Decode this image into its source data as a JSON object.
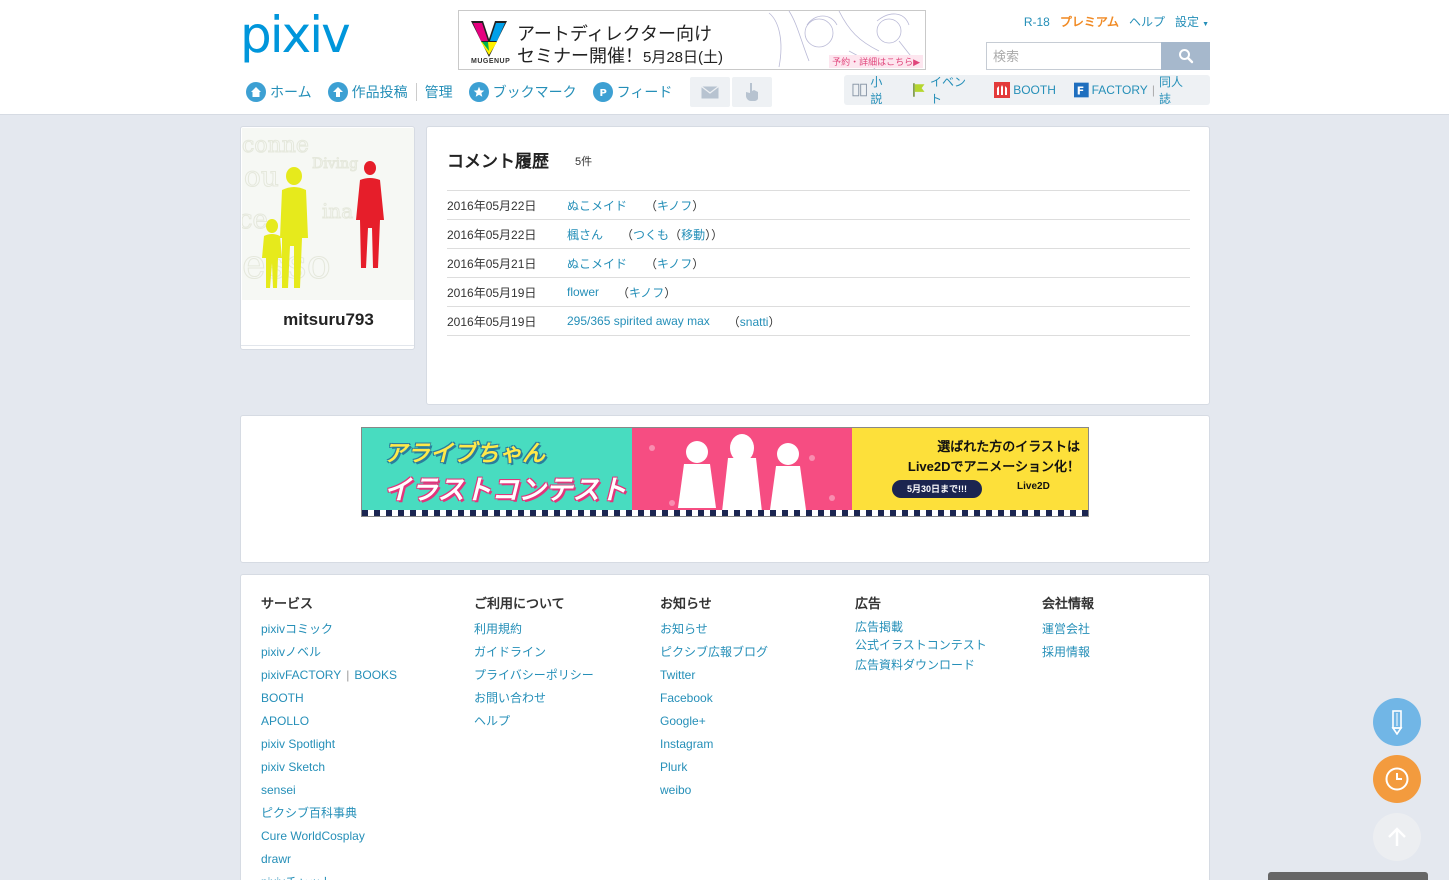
{
  "header": {
    "logo_text": "pixiv",
    "top_ad": {
      "brand": "MUGENUP",
      "line1": "アートディレクター向け",
      "line2": "セミナー開催！",
      "date": "5月28日(土)",
      "more": "予約・詳細はこちら▶"
    },
    "top_links": {
      "r18": "R-18",
      "premium": "プレミアム",
      "help": "ヘルプ",
      "settings": "設定"
    },
    "search": {
      "placeholder": "検索"
    },
    "nav": {
      "home": "ホーム",
      "post": "作品投稿",
      "manage": "管理",
      "bookmark": "ブックマーク",
      "feed": "フィード"
    },
    "services": {
      "novel": "小説",
      "event": "イベント",
      "booth": "BOOTH",
      "factory": "FACTORY",
      "doujin": "同人誌"
    }
  },
  "profile": {
    "username": "mitsuru793"
  },
  "history": {
    "title": "コメント履歴",
    "count": "5件",
    "rows": [
      {
        "date": "2016年05月22日",
        "title": "ぬこメイド",
        "author": "キノフ",
        "suffix": ""
      },
      {
        "date": "2016年05月22日",
        "title": "楓さん",
        "author": "つくも",
        "suffix": "移動"
      },
      {
        "date": "2016年05月21日",
        "title": "ぬこメイド",
        "author": "キノフ",
        "suffix": ""
      },
      {
        "date": "2016年05月19日",
        "title": "flower",
        "author": "キノフ",
        "suffix": ""
      },
      {
        "date": "2016年05月19日",
        "title": "295/365 spirited away max",
        "author": "snatti",
        "suffix": ""
      }
    ]
  },
  "banner": {
    "title1": "アライブちゃん",
    "title2": "イラストコンテスト",
    "right1": "選ばれた方のイラストは",
    "right2": "Live2Dでアニメーション化！",
    "deadline": "5月30日まで!!!",
    "brand": "Live2D"
  },
  "footer": {
    "services": {
      "heading": "サービス",
      "items": [
        "pixivコミック",
        "pixivノベル",
        "pixivFACTORY",
        "BOOKS",
        "BOOTH",
        "APOLLO",
        "pixiv Spotlight",
        "pixiv Sketch",
        "sensei",
        "ピクシブ百科事典",
        "Cure WorldCosplay",
        "drawr",
        "pixivチャット"
      ]
    },
    "usage": {
      "heading": "ご利用について",
      "items": [
        "利用規約",
        "ガイドライン",
        "プライバシーポリシー",
        "お問い合わせ",
        "ヘルプ"
      ]
    },
    "news": {
      "heading": "お知らせ",
      "items": [
        "お知らせ",
        "ピクシブ広報ブログ",
        "Twitter",
        "Facebook",
        "Google+",
        "Instagram",
        "Plurk",
        "weibo"
      ]
    },
    "ads": {
      "heading": "広告",
      "items": [
        "広告掲載",
        "公式イラストコンテスト",
        "広告資料ダウンロード"
      ]
    },
    "company": {
      "heading": "会社情報",
      "items": [
        "運営会社",
        "採用情報"
      ]
    }
  },
  "colors": {
    "link": "#258fb8",
    "premium": "#f08a24",
    "fab_pen": "#71b6e6",
    "fab_clock": "#f39b3e"
  },
  "icons": [
    "home-icon",
    "upload-icon",
    "star-icon",
    "feed-icon",
    "mail-icon",
    "hand-icon",
    "search-icon",
    "pen-icon",
    "clock-icon",
    "arrow-up-icon"
  ]
}
